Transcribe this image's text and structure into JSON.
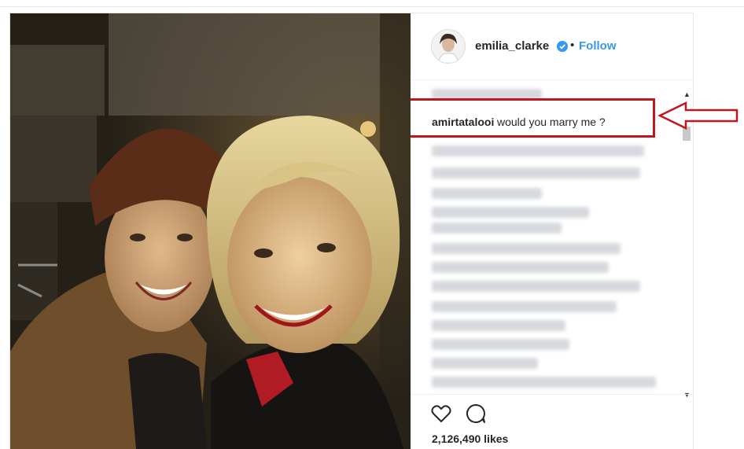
{
  "profile": {
    "username": "emilia_clarke",
    "separator": "•",
    "follow_label": "Follow"
  },
  "highlighted_comment": {
    "username": "amirtatalooi",
    "text": "would you marry me ?"
  },
  "scroll": {
    "up_glyph": "▲",
    "down_glyph": "▼"
  },
  "likes": {
    "count_label": "2,126,490 likes"
  },
  "colors": {
    "follow": "#3897f0",
    "highlight": "#c0161e",
    "text": "#262626"
  },
  "icons": [
    "verified-badge-icon",
    "heart-icon",
    "comment-icon",
    "arrow-left-icon"
  ]
}
